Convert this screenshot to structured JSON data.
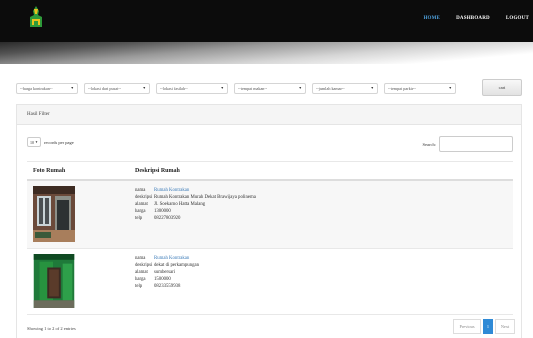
{
  "nav": {
    "items": [
      {
        "label": "HOME",
        "active": true
      },
      {
        "label": "DASHBOARD",
        "active": false
      },
      {
        "label": "LOGOUT",
        "active": false
      }
    ]
  },
  "filters": {
    "selects": [
      "--harga kontrakan--",
      "--lokasi dari pusat--",
      "--lokasi fasilah--",
      "--tempat makan--",
      "--jumlah kamar--",
      "--tempat parkir--"
    ],
    "button": "cari"
  },
  "panel": {
    "heading": "Hasil Filter"
  },
  "controls": {
    "length_value": "10",
    "length_label": "records per page",
    "search_label": "Search:"
  },
  "table": {
    "headers": [
      "Foto Rumah",
      "Deskripsi Rumah"
    ],
    "rows": [
      {
        "nama": "Rumah Kontrakan",
        "deskripsi": "Rumah Kontrakan Murah Dekat Brawijaya polinema",
        "alamat": "Jl. Soekarno Hatta Malang",
        "harga": "1300000",
        "telp": "08227803920"
      },
      {
        "nama": "Rumah Kontrakan",
        "deskripsi": "dekat di perkampungan",
        "alamat": "sumbersari",
        "harga": "1500000",
        "telp": "08233559938"
      }
    ],
    "field_labels": {
      "nama": "nama",
      "deskripsi": "deskripsi",
      "alamat": "alamat",
      "harga": "harga",
      "telp": "telp"
    }
  },
  "footer": {
    "info": "Showing 1 to 2 of 2 entries",
    "prev": "Previous",
    "page": "1",
    "next": "Next"
  },
  "colors": {
    "header_bg": "#0c0c0c",
    "nav_active": "#4fa3e0",
    "link": "#3a7ab8",
    "pager_active": "#2f8ad6"
  }
}
